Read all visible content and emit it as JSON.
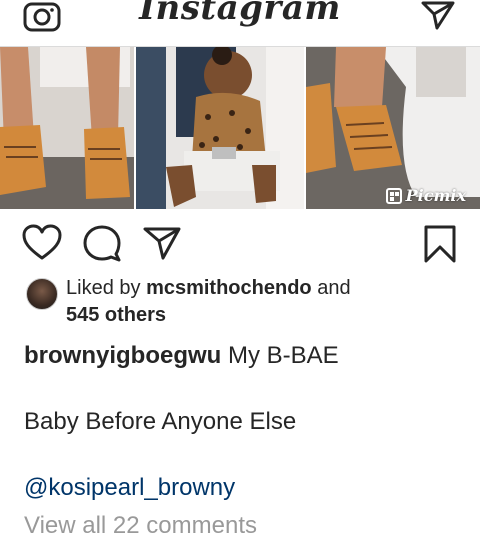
{
  "header": {
    "logo_text": "Instagram",
    "camera_icon": "camera-icon",
    "send_icon": "direct-message-icon"
  },
  "post": {
    "media": {
      "watermark": "Picmix",
      "panels": [
        "feet-in-orange-sneakers",
        "toddler-in-leopard-top-in-high-chair",
        "orange-sneaker-on-foot"
      ]
    },
    "actions": {
      "like_icon": "heart-icon",
      "comment_icon": "comment-icon",
      "share_icon": "share-icon",
      "save_icon": "bookmark-icon"
    },
    "likes": {
      "prefix": "Liked by",
      "user": "mcsmithochendo",
      "conj": "and",
      "others": "545 others"
    },
    "caption": {
      "username": "brownyigboegwu",
      "text": "My B-BAE",
      "line2": "Baby Before Anyone Else",
      "mention": "@kosipearl_browny"
    },
    "view_comments": "View all 22 comments"
  }
}
